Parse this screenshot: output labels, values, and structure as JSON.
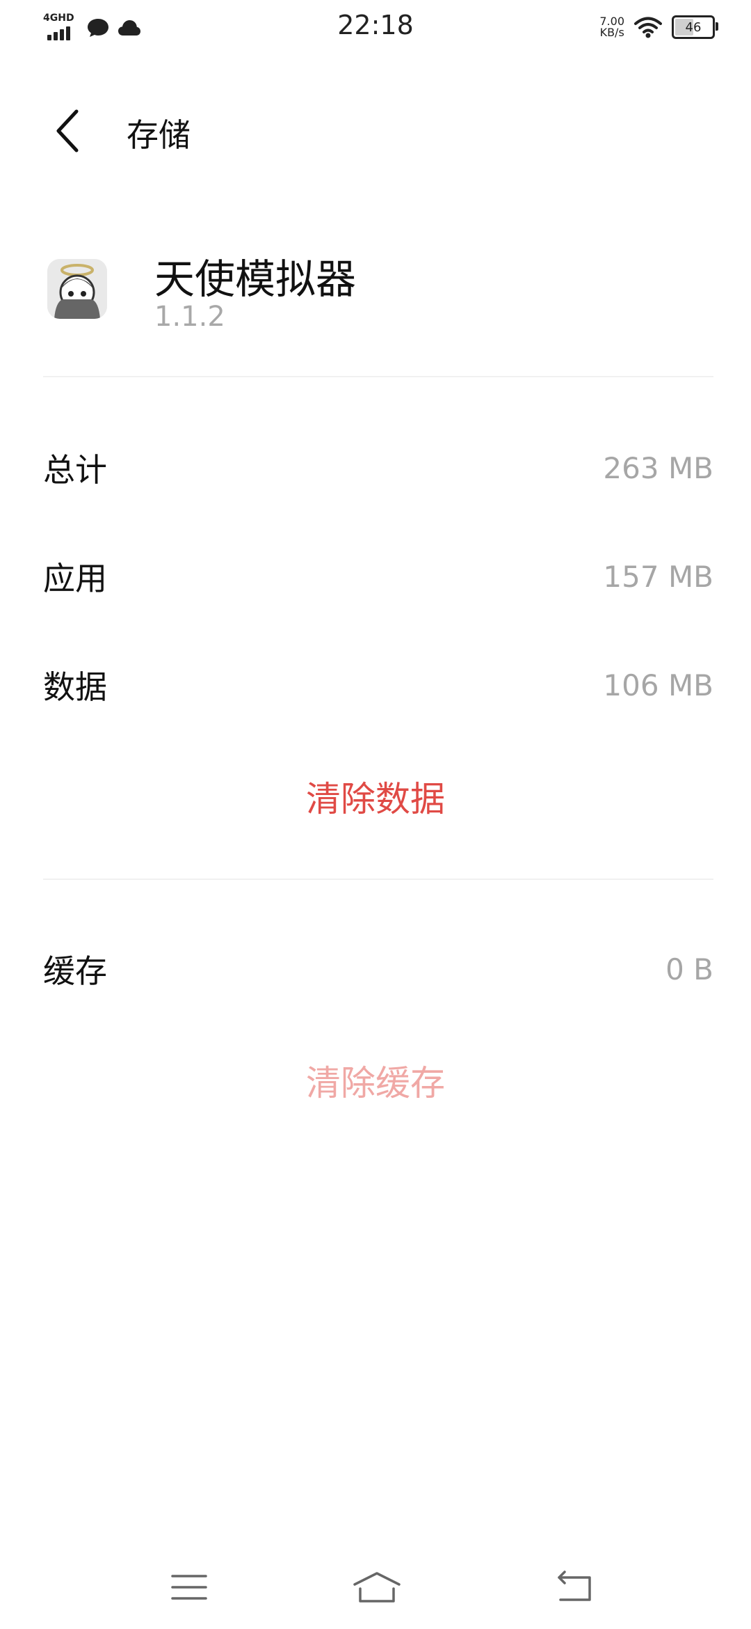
{
  "status_bar": {
    "time": "22:18",
    "network_label": "4GHD",
    "speed_value": "7.00",
    "speed_unit": "KB/s",
    "battery": "46",
    "battery_level": 0.46
  },
  "header": {
    "title": "存储"
  },
  "app": {
    "name": "天使模拟器",
    "version": "1.1.2"
  },
  "storage": {
    "rows": [
      {
        "label": "总计",
        "value": "263 MB"
      },
      {
        "label": "应用",
        "value": "157 MB"
      },
      {
        "label": "数据",
        "value": "106 MB"
      }
    ],
    "clear_data_label": "清除数据",
    "cache": {
      "label": "缓存",
      "value": "0 B"
    },
    "clear_cache_label": "清除缓存"
  },
  "colors": {
    "accent_red": "#e04a45",
    "disabled_red": "#f0a8a5",
    "secondary_text": "#a6a6a6"
  },
  "icons": {
    "back": "chevron-left-icon",
    "menu": "menu-icon",
    "home": "home-icon",
    "back_nav": "back-arrow-icon"
  }
}
